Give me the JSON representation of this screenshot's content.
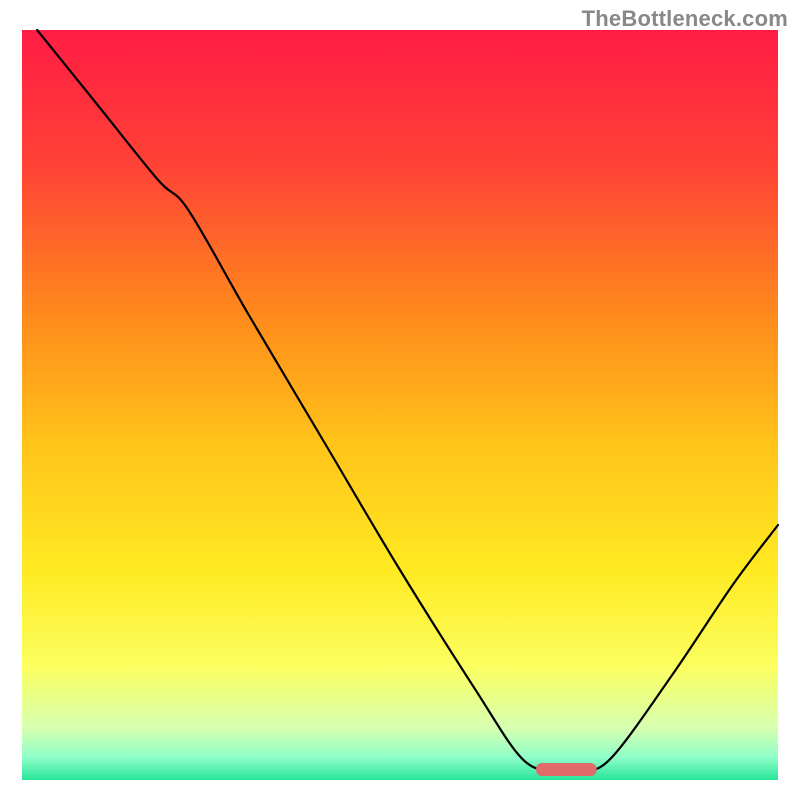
{
  "watermark": "TheBottleneck.com",
  "chart_data": {
    "type": "line",
    "title": "",
    "xlabel": "",
    "ylabel": "",
    "xlim": [
      0,
      100
    ],
    "ylim": [
      0,
      100
    ],
    "axis_visible": false,
    "grid": false,
    "background_gradient": {
      "direction": "vertical",
      "stops": [
        {
          "offset": 0.0,
          "color": "#ff1c44"
        },
        {
          "offset": 0.18,
          "color": "#ff4236"
        },
        {
          "offset": 0.38,
          "color": "#ff8a1c"
        },
        {
          "offset": 0.55,
          "color": "#ffc31a"
        },
        {
          "offset": 0.72,
          "color": "#ffea22"
        },
        {
          "offset": 0.85,
          "color": "#fbff60"
        },
        {
          "offset": 0.93,
          "color": "#d7ffb0"
        },
        {
          "offset": 0.97,
          "color": "#8fffc8"
        },
        {
          "offset": 1.0,
          "color": "#28e49a"
        }
      ]
    },
    "series": [
      {
        "name": "bottleneck-curve",
        "stroke": "#000000",
        "stroke_width": 2.2,
        "points": [
          {
            "x": 2,
            "y": 100
          },
          {
            "x": 10,
            "y": 90
          },
          {
            "x": 18,
            "y": 80
          },
          {
            "x": 22,
            "y": 76
          },
          {
            "x": 30,
            "y": 62
          },
          {
            "x": 40,
            "y": 45
          },
          {
            "x": 50,
            "y": 28
          },
          {
            "x": 60,
            "y": 12
          },
          {
            "x": 66,
            "y": 3
          },
          {
            "x": 70,
            "y": 1.2
          },
          {
            "x": 74,
            "y": 1.2
          },
          {
            "x": 78,
            "y": 3
          },
          {
            "x": 86,
            "y": 14
          },
          {
            "x": 94,
            "y": 26
          },
          {
            "x": 100,
            "y": 34
          }
        ]
      }
    ],
    "marker": {
      "name": "optimal-zone",
      "shape": "rounded-bar",
      "x_start": 68,
      "x_end": 76,
      "y": 1.4,
      "fill": "#e26a6a"
    },
    "notes": "Values are read as percentages of the plot area; the figure has no numeric axis labels — only a qualitative gradient from red (top, bad) to green (bottom, good). The black curve descends steeply from upper-left, flattens near the bottom around x≈68–76 (the pink marker), then rises toward the right edge."
  }
}
